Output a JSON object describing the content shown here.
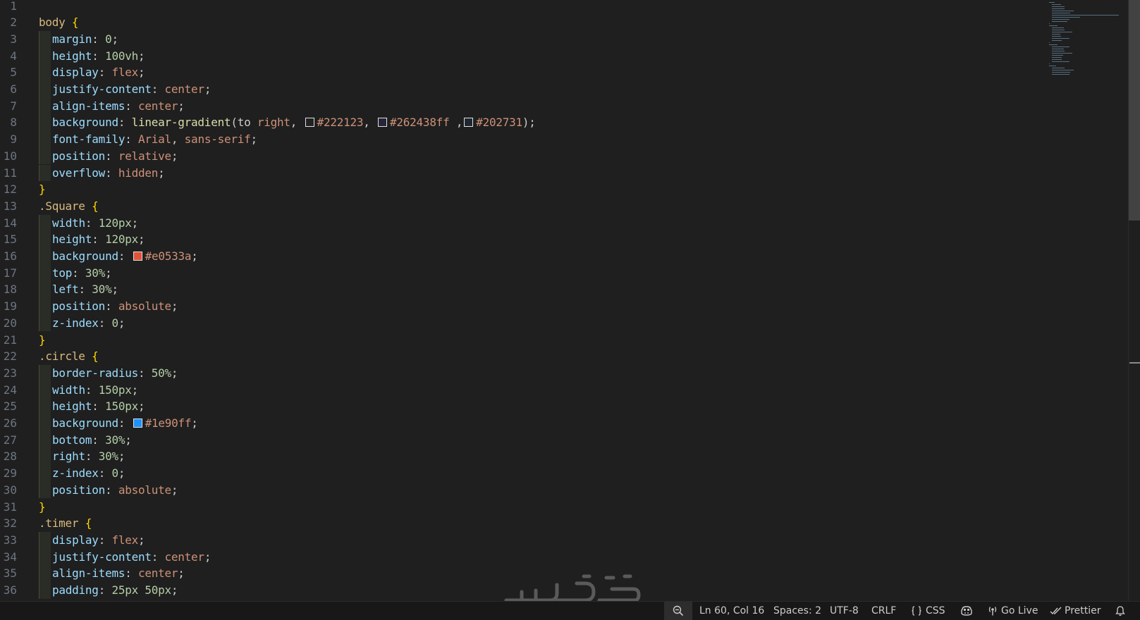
{
  "editor": {
    "lines": [
      {
        "n": "1",
        "indent": false,
        "tokens": []
      },
      {
        "n": "2",
        "indent": false,
        "tokens": [
          {
            "c": "sel",
            "t": "body "
          },
          {
            "c": "brace",
            "t": "{"
          }
        ]
      },
      {
        "n": "3",
        "indent": true,
        "tokens": [
          {
            "c": "prop",
            "t": "margin"
          },
          {
            "c": "punct",
            "t": ": "
          },
          {
            "c": "num",
            "t": "0"
          },
          {
            "c": "punct",
            "t": ";"
          }
        ]
      },
      {
        "n": "4",
        "indent": true,
        "tokens": [
          {
            "c": "prop",
            "t": "height"
          },
          {
            "c": "punct",
            "t": ": "
          },
          {
            "c": "num",
            "t": "100vh"
          },
          {
            "c": "punct",
            "t": ";"
          }
        ]
      },
      {
        "n": "5",
        "indent": true,
        "tokens": [
          {
            "c": "prop",
            "t": "display"
          },
          {
            "c": "punct",
            "t": ": "
          },
          {
            "c": "val",
            "t": "flex"
          },
          {
            "c": "punct",
            "t": ";"
          }
        ]
      },
      {
        "n": "6",
        "indent": true,
        "tokens": [
          {
            "c": "prop",
            "t": "justify-content"
          },
          {
            "c": "punct",
            "t": ": "
          },
          {
            "c": "val",
            "t": "center"
          },
          {
            "c": "punct",
            "t": ";"
          }
        ]
      },
      {
        "n": "7",
        "indent": true,
        "tokens": [
          {
            "c": "prop",
            "t": "align-items"
          },
          {
            "c": "punct",
            "t": ": "
          },
          {
            "c": "val",
            "t": "center"
          },
          {
            "c": "punct",
            "t": ";"
          }
        ]
      },
      {
        "n": "8",
        "indent": true,
        "tokens": [
          {
            "c": "prop",
            "t": "background"
          },
          {
            "c": "punct",
            "t": ": "
          },
          {
            "c": "func",
            "t": "linear-gradient"
          },
          {
            "c": "punct",
            "t": "(to "
          },
          {
            "c": "val",
            "t": "right"
          },
          {
            "c": "punct",
            "t": ", "
          },
          {
            "c": "swatch",
            "color": "#222123"
          },
          {
            "c": "val",
            "t": "#222123"
          },
          {
            "c": "punct",
            "t": ", "
          },
          {
            "c": "swatch",
            "color": "#262438"
          },
          {
            "c": "val",
            "t": "#262438ff"
          },
          {
            "c": "punct",
            "t": " ,"
          },
          {
            "c": "swatch",
            "color": "#202731"
          },
          {
            "c": "val",
            "t": "#202731"
          },
          {
            "c": "punct",
            "t": ");"
          }
        ]
      },
      {
        "n": "9",
        "indent": true,
        "tokens": [
          {
            "c": "prop",
            "t": "font-family"
          },
          {
            "c": "punct",
            "t": ": "
          },
          {
            "c": "val",
            "t": "Arial"
          },
          {
            "c": "punct",
            "t": ", "
          },
          {
            "c": "val",
            "t": "sans-serif"
          },
          {
            "c": "punct",
            "t": ";"
          }
        ]
      },
      {
        "n": "10",
        "indent": true,
        "tokens": [
          {
            "c": "prop",
            "t": "position"
          },
          {
            "c": "punct",
            "t": ": "
          },
          {
            "c": "val",
            "t": "relative"
          },
          {
            "c": "punct",
            "t": ";"
          }
        ]
      },
      {
        "n": "11",
        "indent": true,
        "tokens": [
          {
            "c": "prop",
            "t": "overflow"
          },
          {
            "c": "punct",
            "t": ": "
          },
          {
            "c": "val",
            "t": "hidden"
          },
          {
            "c": "punct",
            "t": ";"
          }
        ]
      },
      {
        "n": "12",
        "indent": false,
        "tokens": [
          {
            "c": "brace",
            "t": "}"
          }
        ]
      },
      {
        "n": "13",
        "indent": false,
        "tokens": [
          {
            "c": "sel",
            "t": ".Square "
          },
          {
            "c": "brace",
            "t": "{"
          }
        ]
      },
      {
        "n": "14",
        "indent": true,
        "tokens": [
          {
            "c": "prop",
            "t": "width"
          },
          {
            "c": "punct",
            "t": ": "
          },
          {
            "c": "num",
            "t": "120px"
          },
          {
            "c": "punct",
            "t": ";"
          }
        ]
      },
      {
        "n": "15",
        "indent": true,
        "tokens": [
          {
            "c": "prop",
            "t": "height"
          },
          {
            "c": "punct",
            "t": ": "
          },
          {
            "c": "num",
            "t": "120px"
          },
          {
            "c": "punct",
            "t": ";"
          }
        ]
      },
      {
        "n": "16",
        "indent": true,
        "tokens": [
          {
            "c": "prop",
            "t": "background"
          },
          {
            "c": "punct",
            "t": ": "
          },
          {
            "c": "swatch",
            "color": "#e0533a"
          },
          {
            "c": "val",
            "t": "#e0533a"
          },
          {
            "c": "punct",
            "t": ";"
          }
        ]
      },
      {
        "n": "17",
        "indent": true,
        "tokens": [
          {
            "c": "prop",
            "t": "top"
          },
          {
            "c": "punct",
            "t": ": "
          },
          {
            "c": "num",
            "t": "30%"
          },
          {
            "c": "punct",
            "t": ";"
          }
        ]
      },
      {
        "n": "18",
        "indent": true,
        "tokens": [
          {
            "c": "prop",
            "t": "left"
          },
          {
            "c": "punct",
            "t": ": "
          },
          {
            "c": "num",
            "t": "30%"
          },
          {
            "c": "punct",
            "t": ";"
          }
        ]
      },
      {
        "n": "19",
        "indent": true,
        "tokens": [
          {
            "c": "prop",
            "t": "position"
          },
          {
            "c": "punct",
            "t": ": "
          },
          {
            "c": "val",
            "t": "absolute"
          },
          {
            "c": "punct",
            "t": ";"
          }
        ]
      },
      {
        "n": "20",
        "indent": true,
        "tokens": [
          {
            "c": "prop",
            "t": "z-index"
          },
          {
            "c": "punct",
            "t": ": "
          },
          {
            "c": "num",
            "t": "0"
          },
          {
            "c": "punct",
            "t": ";"
          }
        ]
      },
      {
        "n": "21",
        "indent": false,
        "tokens": [
          {
            "c": "brace",
            "t": "}"
          }
        ]
      },
      {
        "n": "22",
        "indent": false,
        "tokens": [
          {
            "c": "sel",
            "t": ".circle "
          },
          {
            "c": "brace",
            "t": "{"
          }
        ]
      },
      {
        "n": "23",
        "indent": true,
        "tokens": [
          {
            "c": "prop",
            "t": "border-radius"
          },
          {
            "c": "punct",
            "t": ": "
          },
          {
            "c": "num",
            "t": "50%"
          },
          {
            "c": "punct",
            "t": ";"
          }
        ]
      },
      {
        "n": "24",
        "indent": true,
        "tokens": [
          {
            "c": "prop",
            "t": "width"
          },
          {
            "c": "punct",
            "t": ": "
          },
          {
            "c": "num",
            "t": "150px"
          },
          {
            "c": "punct",
            "t": ";"
          }
        ]
      },
      {
        "n": "25",
        "indent": true,
        "tokens": [
          {
            "c": "prop",
            "t": "height"
          },
          {
            "c": "punct",
            "t": ": "
          },
          {
            "c": "num",
            "t": "150px"
          },
          {
            "c": "punct",
            "t": ";"
          }
        ]
      },
      {
        "n": "26",
        "indent": true,
        "tokens": [
          {
            "c": "prop",
            "t": "background"
          },
          {
            "c": "punct",
            "t": ": "
          },
          {
            "c": "swatch",
            "color": "#1e90ff"
          },
          {
            "c": "val",
            "t": "#1e90ff"
          },
          {
            "c": "punct",
            "t": ";"
          }
        ]
      },
      {
        "n": "27",
        "indent": true,
        "tokens": [
          {
            "c": "prop",
            "t": "bottom"
          },
          {
            "c": "punct",
            "t": ": "
          },
          {
            "c": "num",
            "t": "30%"
          },
          {
            "c": "punct",
            "t": ";"
          }
        ]
      },
      {
        "n": "28",
        "indent": true,
        "tokens": [
          {
            "c": "prop",
            "t": "right"
          },
          {
            "c": "punct",
            "t": ": "
          },
          {
            "c": "num",
            "t": "30%"
          },
          {
            "c": "punct",
            "t": ";"
          }
        ]
      },
      {
        "n": "29",
        "indent": true,
        "tokens": [
          {
            "c": "prop",
            "t": "z-index"
          },
          {
            "c": "punct",
            "t": ": "
          },
          {
            "c": "num",
            "t": "0"
          },
          {
            "c": "punct",
            "t": ";"
          }
        ]
      },
      {
        "n": "30",
        "indent": true,
        "tokens": [
          {
            "c": "prop",
            "t": "position"
          },
          {
            "c": "punct",
            "t": ": "
          },
          {
            "c": "val",
            "t": "absolute"
          },
          {
            "c": "punct",
            "t": ";"
          }
        ]
      },
      {
        "n": "31",
        "indent": false,
        "tokens": [
          {
            "c": "brace",
            "t": "}"
          }
        ]
      },
      {
        "n": "32",
        "indent": false,
        "tokens": [
          {
            "c": "sel",
            "t": ".timer "
          },
          {
            "c": "brace",
            "t": "{"
          }
        ]
      },
      {
        "n": "33",
        "indent": true,
        "tokens": [
          {
            "c": "prop",
            "t": "display"
          },
          {
            "c": "punct",
            "t": ": "
          },
          {
            "c": "val",
            "t": "flex"
          },
          {
            "c": "punct",
            "t": ";"
          }
        ]
      },
      {
        "n": "34",
        "indent": true,
        "tokens": [
          {
            "c": "prop",
            "t": "justify-content"
          },
          {
            "c": "punct",
            "t": ": "
          },
          {
            "c": "val",
            "t": "center"
          },
          {
            "c": "punct",
            "t": ";"
          }
        ]
      },
      {
        "n": "35",
        "indent": true,
        "tokens": [
          {
            "c": "prop",
            "t": "align-items"
          },
          {
            "c": "punct",
            "t": ": "
          },
          {
            "c": "val",
            "t": "center"
          },
          {
            "c": "punct",
            "t": ";"
          }
        ]
      },
      {
        "n": "36",
        "indent": true,
        "tokens": [
          {
            "c": "prop",
            "t": "padding"
          },
          {
            "c": "punct",
            "t": ": "
          },
          {
            "c": "num",
            "t": "25px 50px"
          },
          {
            "c": "punct",
            "t": ";"
          }
        ]
      }
    ]
  },
  "status_bar": {
    "zoom_icon": "zoom-out-icon",
    "cursor_position": "Ln 60, Col 16",
    "indentation": "Spaces: 2",
    "encoding": "UTF-8",
    "line_ending": "CRLF",
    "language_icon": "braces-icon",
    "language": "CSS",
    "copilot_icon": "copilot-icon",
    "go_live_icon": "broadcast-icon",
    "go_live": "Go Live",
    "prettier_icon": "double-check-icon",
    "prettier": "Prettier",
    "notifications_icon": "bell-icon"
  },
  "watermark": {
    "text": "خمسات"
  },
  "colors": {
    "editor_background": "#1f1f1f",
    "status_bar_background": "#181818",
    "selector": "#d7ba7d",
    "property": "#9cdcfe",
    "value": "#ce9178",
    "number": "#b5cea8",
    "brace": "#ffd700"
  }
}
